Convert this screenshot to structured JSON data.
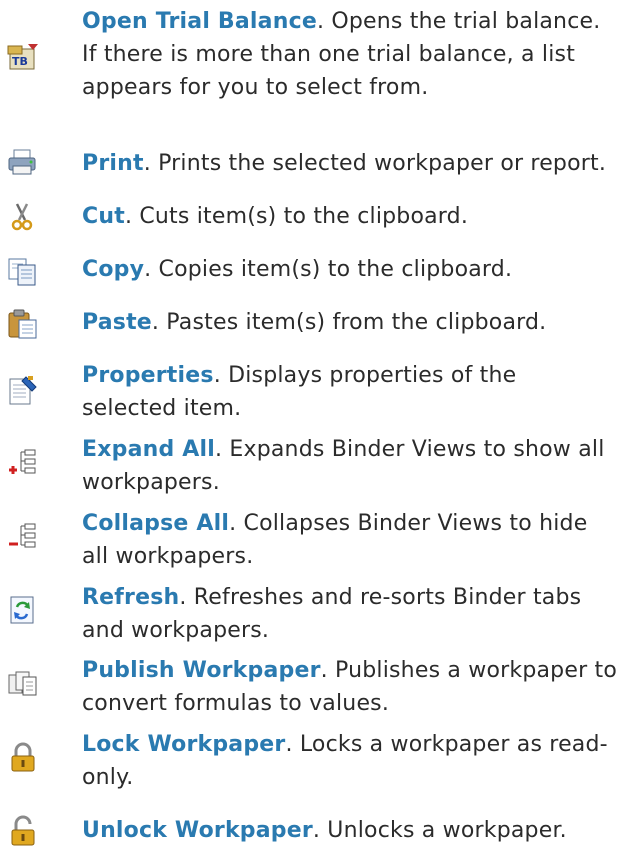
{
  "items": [
    {
      "name": "Open Trial Balance",
      "desc": ". Opens the trial balance. If there is more than one trial balance, a list appears for you to select from.",
      "icon": "open-trial-balance-icon"
    },
    {
      "name": "Print",
      "desc": ". Prints the selected workpaper or report.",
      "icon": "printer-icon"
    },
    {
      "name": "Cut",
      "desc": ". Cuts item(s) to the clipboard.",
      "icon": "scissors-icon"
    },
    {
      "name": "Copy",
      "desc": ". Copies item(s) to the clipboard.",
      "icon": "copy-icon"
    },
    {
      "name": "Paste",
      "desc": ". Pastes item(s) from the clipboard.",
      "icon": "paste-icon"
    },
    {
      "name": "Properties",
      "desc": ". Displays properties of the selected item.",
      "icon": "properties-icon"
    },
    {
      "name": "Expand All",
      "desc": ". Expands Binder Views to show all workpapers.",
      "icon": "expand-all-icon"
    },
    {
      "name": "Collapse All",
      "desc": ". Collapses Binder Views to hide all workpapers.",
      "icon": "collapse-all-icon"
    },
    {
      "name": "Refresh",
      "desc": ". Refreshes and re-sorts Binder tabs and workpapers.",
      "icon": "refresh-icon"
    },
    {
      "name": "Publish Workpaper",
      "desc": ". Publishes a workpaper to convert formulas to values.",
      "icon": "publish-workpaper-icon"
    },
    {
      "name": "Lock Workpaper",
      "desc": ". Locks a workpaper as read-only.",
      "icon": "lock-icon"
    },
    {
      "name": "Unlock Workpaper",
      "desc": ". Unlocks a workpaper.",
      "icon": "unlock-icon"
    }
  ]
}
